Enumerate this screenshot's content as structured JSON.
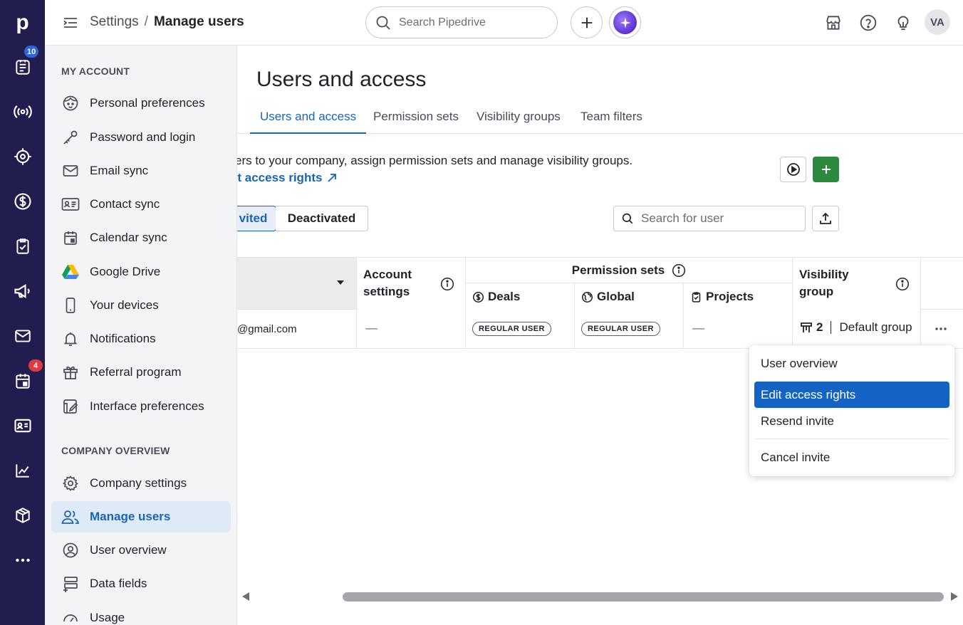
{
  "app": {
    "logo": "p"
  },
  "rail": {
    "items": [
      {
        "name": "leads-icon",
        "badge": "10"
      },
      {
        "name": "broadcast-icon"
      },
      {
        "name": "target-icon"
      },
      {
        "name": "dollar-icon"
      },
      {
        "name": "clipboard-check-icon"
      },
      {
        "name": "megaphone-icon"
      },
      {
        "name": "mail-icon"
      },
      {
        "name": "calendar-icon",
        "badge": "4"
      },
      {
        "name": "contact-card-icon"
      },
      {
        "name": "chart-icon"
      },
      {
        "name": "box-icon"
      },
      {
        "name": "more-icon"
      }
    ],
    "badge_blue": "#2f63d8",
    "badge_red": "#e03a3e"
  },
  "header": {
    "breadcrumb_parent": "Settings",
    "breadcrumb_sep": "/",
    "breadcrumb_current": "Manage users",
    "search_placeholder": "Search Pipedrive",
    "avatar_initials": "VA"
  },
  "sidebar": {
    "section_account": "MY ACCOUNT",
    "account_items": [
      {
        "label": "Personal preferences",
        "icon": "face-icon"
      },
      {
        "label": "Password and login",
        "icon": "key-icon"
      },
      {
        "label": "Email sync",
        "icon": "envelope-icon"
      },
      {
        "label": "Contact sync",
        "icon": "id-card-icon"
      },
      {
        "label": "Calendar sync",
        "icon": "calendar-sync-icon"
      },
      {
        "label": "Google Drive",
        "icon": "google-drive-icon"
      },
      {
        "label": "Your devices",
        "icon": "phone-icon"
      },
      {
        "label": "Notifications",
        "icon": "bell-icon"
      },
      {
        "label": "Referral program",
        "icon": "gift-icon"
      },
      {
        "label": "Interface preferences",
        "icon": "interface-edit-icon"
      }
    ],
    "section_company": "COMPANY OVERVIEW",
    "company_items": [
      {
        "label": "Company settings",
        "icon": "gear-icon"
      },
      {
        "label": "Manage users",
        "icon": "users-icon",
        "active": true
      },
      {
        "label": "User overview",
        "icon": "user-circle-icon"
      },
      {
        "label": "Data fields",
        "icon": "data-fields-icon"
      },
      {
        "label": "Usage",
        "icon": "gauge-icon"
      }
    ]
  },
  "main": {
    "title": "Users and access",
    "tabs": [
      "Users and access",
      "Permission sets",
      "Visibility groups",
      "Team filters"
    ],
    "description": "ers to your company, assign permission sets and manage visibility groups.",
    "learn_link": "ut access rights",
    "filter_tabs": [
      "vited",
      "Deactivated"
    ],
    "user_search_placeholder": "Search for user"
  },
  "table": {
    "headers": {
      "account_settings_line1": "Account",
      "account_settings_line2": "settings",
      "permission_sets": "Permission sets",
      "deals": "Deals",
      "global": "Global",
      "projects": "Projects",
      "visibility_line1": "Visibility",
      "visibility_line2": "group"
    },
    "rows": [
      {
        "email": "@gmail.com",
        "account_settings": "—",
        "deals": "REGULAR USER",
        "global": "REGULAR USER",
        "projects": "—",
        "visibility_number": "2",
        "visibility_group": "Default group"
      }
    ]
  },
  "context_menu": {
    "items": [
      "User overview",
      "Edit access rights",
      "Resend invite",
      "Cancel invite"
    ],
    "selected": "Edit access rights"
  },
  "colors": {
    "rail_bg": "#221d4f",
    "accent": "#1a64b4",
    "add_green": "#2b8a3e",
    "menu_selected": "#1462c4"
  }
}
